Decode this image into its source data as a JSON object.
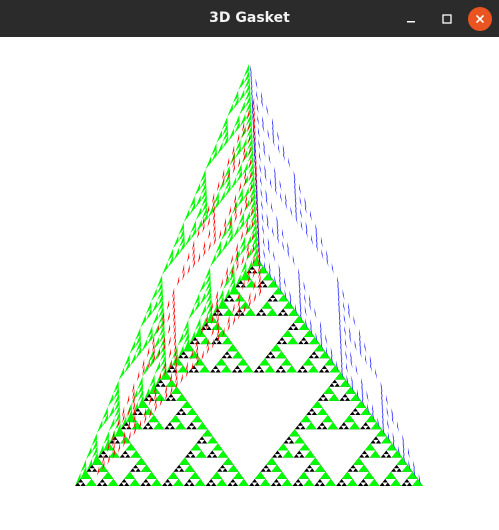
{
  "window": {
    "title": "3D Gasket"
  },
  "titlebar_buttons": {
    "minimize_icon": "minimize-icon",
    "maximize_icon": "maximize-icon",
    "close_icon": "close-icon",
    "close_color": "#e95420"
  },
  "gasket": {
    "face_colors": {
      "left": "#00ff00",
      "right_back": "#0000ff",
      "inner": "#ff0000",
      "bottom": "#000000"
    },
    "background": "#ffffff"
  }
}
